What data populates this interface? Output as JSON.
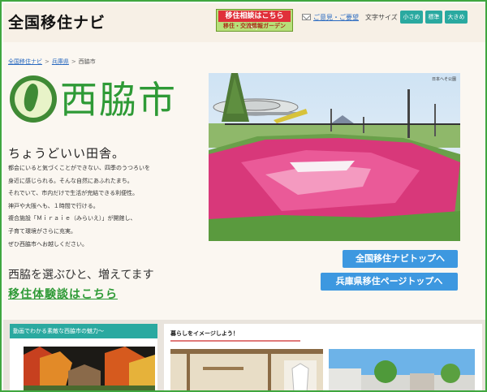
{
  "header": {
    "site_title": "全国移住ナビ",
    "banner_line1": "移住相談はこちらへ！",
    "banner_line2": "移住・交流情報ガーデン",
    "contact_label": "ご意見・ご要望",
    "font_size_label": "文字サイズ",
    "font_buttons": [
      "小さめ",
      "標準",
      "大きめ"
    ]
  },
  "breadcrumb": [
    "全国移住ナビ",
    "兵庫県",
    "西脇市"
  ],
  "city": {
    "name": "西脇市"
  },
  "photo_credit": "日本へそ公園",
  "tagline": "ちょうどいい田舎。",
  "body_lines": [
    "都会にいると気づくことができない、四季のうつろいを",
    "身近に感じられる。そんな自然にあふれたまち。",
    "それでいて、市内だけで生活が完結できる利便性。",
    "神戸や大阪へも、１時間で行ける。",
    "複合施設「Ｍｉｒａｉｅ（みらいえ）」が開館し、",
    "子育て環境がさらに充実。",
    "ぜひ西脇市へお越しください。"
  ],
  "lead_text": "西脇を選ぶひと、増えてます",
  "experience_link": "移住体験談はこちら",
  "buttons": {
    "navi_top": "全国移住ナビトップへ",
    "pref_top": "兵庫県移住ページトップへ"
  },
  "sections": {
    "video_heading": "動画でわかる素敵な西脇市の魅力〜",
    "life_heading": "暮らしをイメージしよう！"
  },
  "colors": {
    "accent_green": "#2e9a36",
    "teal": "#2aa9a0",
    "blue_button": "#3d98e0",
    "frame_green": "#3fa63f"
  }
}
